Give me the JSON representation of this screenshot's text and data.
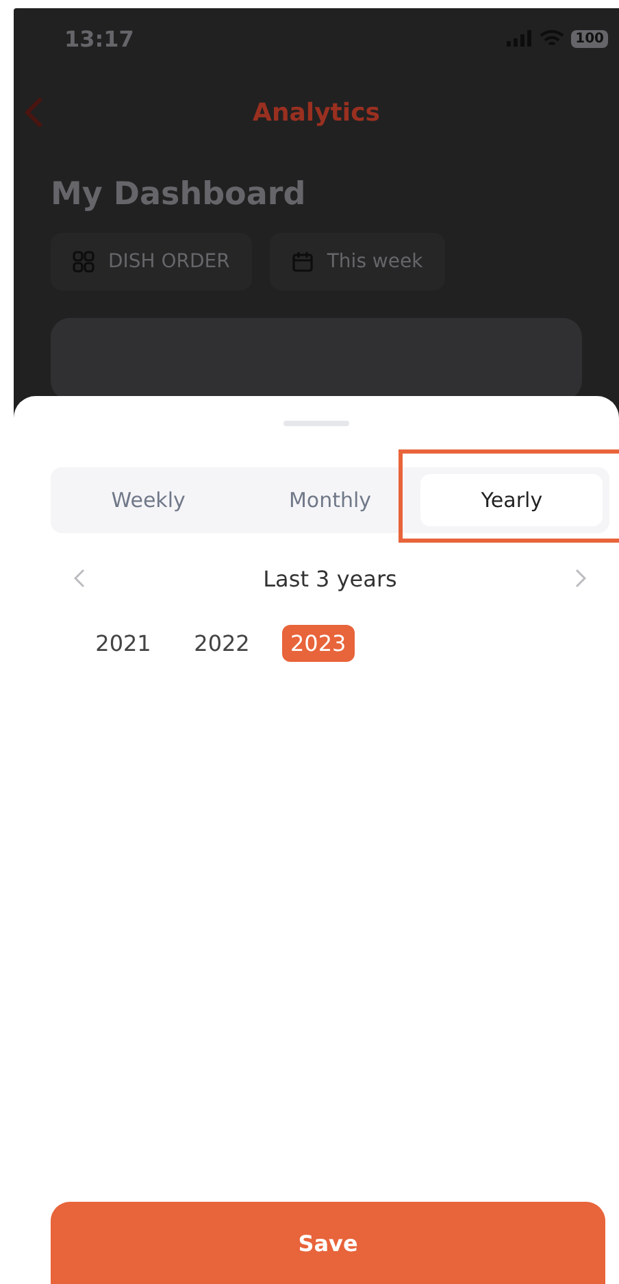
{
  "status_bar": {
    "time": "13:17",
    "battery": "100"
  },
  "header": {
    "title": "Analytics"
  },
  "dashboard": {
    "title": "My Dashboard",
    "chips": [
      {
        "kind": "grid",
        "label": "DISH ORDER"
      },
      {
        "kind": "calendar",
        "label": "This week"
      }
    ]
  },
  "sheet": {
    "tabs": [
      {
        "label": "Weekly",
        "selected": false
      },
      {
        "label": "Monthly",
        "selected": false
      },
      {
        "label": "Yearly",
        "selected": true
      }
    ],
    "range": {
      "label": "Last 3 years"
    },
    "years": [
      {
        "label": "2021",
        "selected": false
      },
      {
        "label": "2022",
        "selected": false
      },
      {
        "label": "2023",
        "selected": true
      }
    ],
    "save_button": "Save"
  }
}
